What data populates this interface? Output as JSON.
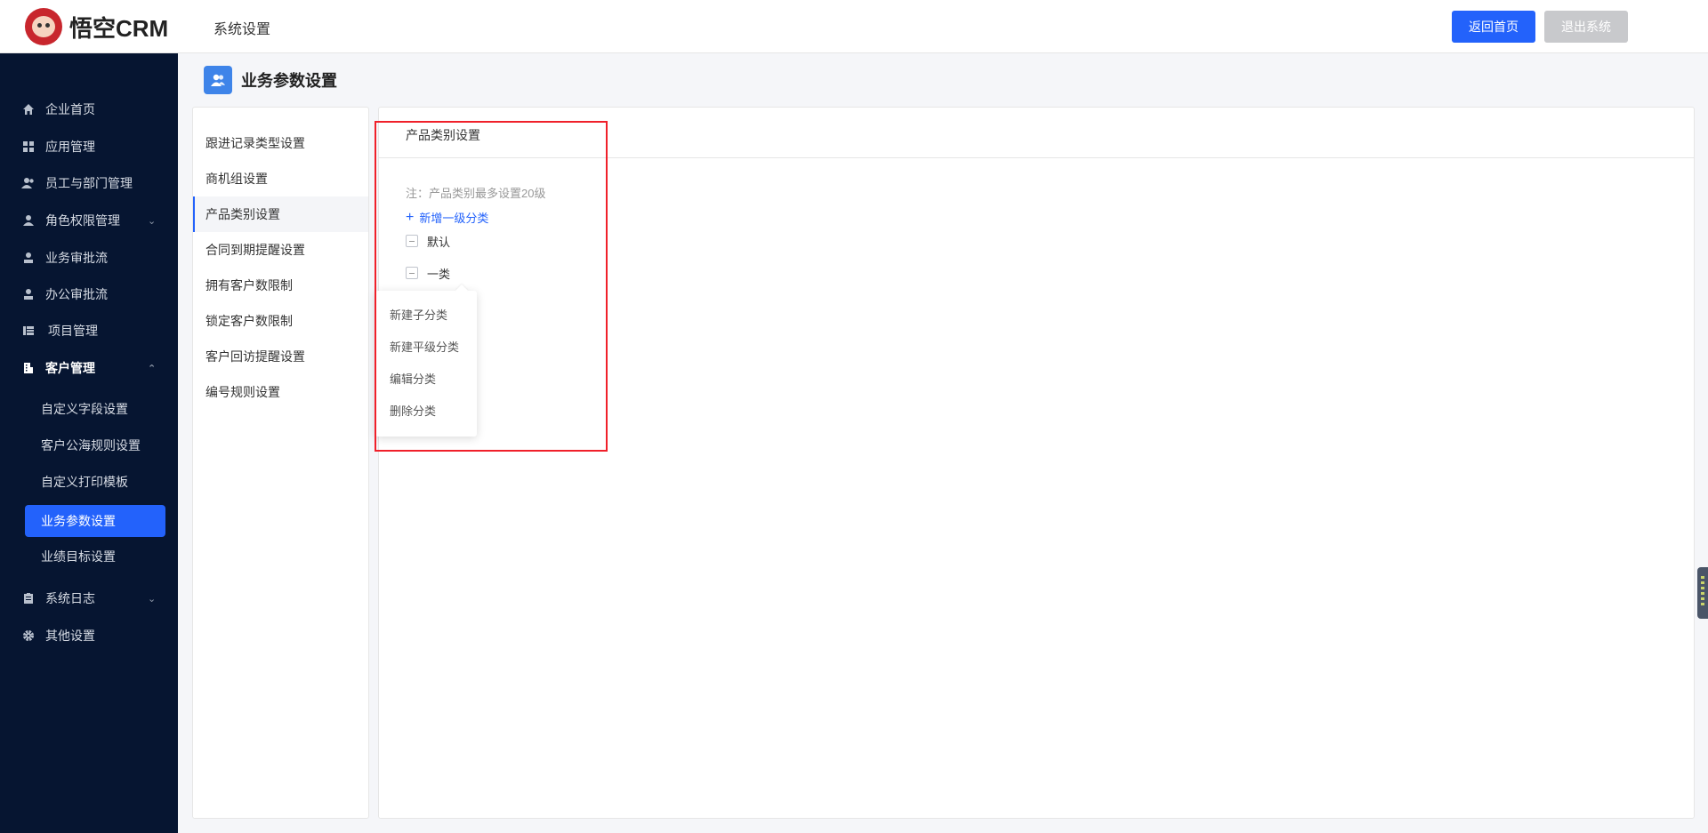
{
  "header": {
    "logo_text": "悟空CRM",
    "title": "系统设置",
    "buttons": {
      "home": "返回首页",
      "logout": "退出系统"
    }
  },
  "sidebar": {
    "items": [
      {
        "label": "企业首页",
        "icon": "home-icon"
      },
      {
        "label": "应用管理",
        "icon": "grid-icon"
      },
      {
        "label": "员工与部门管理",
        "icon": "users-icon"
      },
      {
        "label": "角色权限管理",
        "icon": "user-icon",
        "chevron": "down"
      },
      {
        "label": "业务审批流",
        "icon": "approval-icon"
      },
      {
        "label": "办公审批流",
        "icon": "approval-icon"
      },
      {
        "label": "项目管理",
        "icon": "project-icon"
      },
      {
        "label": "客户管理",
        "icon": "building-icon",
        "chevron": "up"
      },
      {
        "label": "系统日志",
        "icon": "clipboard-icon",
        "chevron": "down"
      },
      {
        "label": "其他设置",
        "icon": "gear-icon"
      }
    ],
    "sub_items": [
      "自定义字段设置",
      "客户公海规则设置",
      "自定义打印模板",
      "业务参数设置",
      "业绩目标设置"
    ],
    "active_sub": "业务参数设置"
  },
  "page": {
    "title": "业务参数设置"
  },
  "settings_menu": {
    "items": [
      "跟进记录类型设置",
      "商机组设置",
      "产品类别设置",
      "合同到期提醒设置",
      "拥有客户数限制",
      "锁定客户数限制",
      "客户回访提醒设置",
      "编号规则设置"
    ],
    "active": "产品类别设置"
  },
  "content": {
    "title": "产品类别设置",
    "note": "注：产品类别最多设置20级",
    "add_label": "新增一级分类",
    "tree": [
      {
        "label": "默认"
      },
      {
        "label": "一类"
      }
    ]
  },
  "context_menu": {
    "items": [
      "新建子分类",
      "新建平级分类",
      "编辑分类",
      "删除分类"
    ]
  },
  "colors": {
    "accent": "#2362fb",
    "sidebar_bg": "#061531",
    "highlight": "#f0202a"
  }
}
